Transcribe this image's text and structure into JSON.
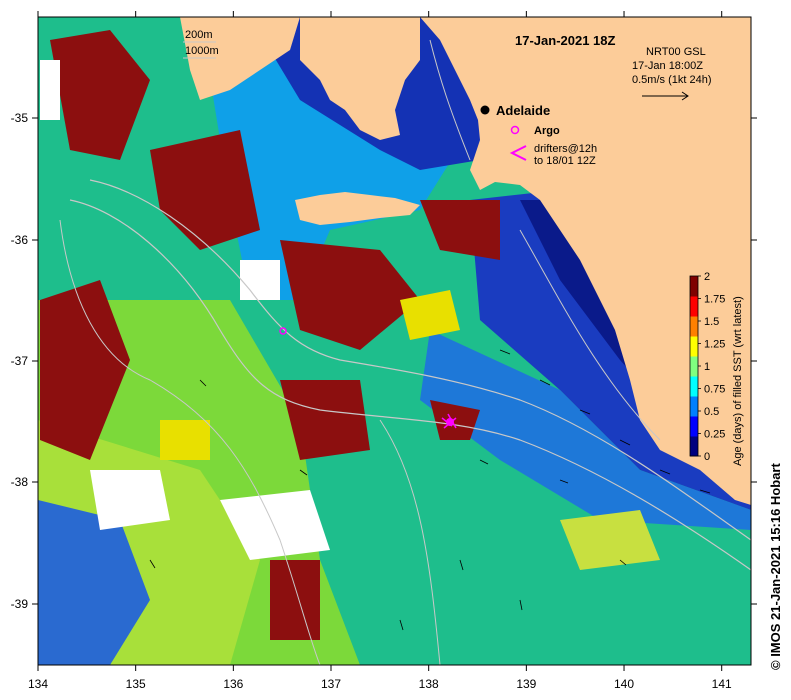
{
  "map": {
    "date_title": "17-Jan-2021 18Z",
    "product_line1": "NRT00 GSL",
    "product_line2": "17-Jan 18:00Z",
    "product_line3": "0.5m/s (1kt 24h)",
    "isobath_200": "200m",
    "isobath_1000": "1000m",
    "city_label": "Adelaide",
    "argo_label": "Argo",
    "drifter_label1": "drifters@12h",
    "drifter_label2": "to 18/01 12Z",
    "credit": "© IMOS 21-Jan-2021 15:16 Hobart",
    "colors": {
      "land": "#fccc99",
      "argo": "#ff00ff",
      "drifter": "#ff00ff"
    },
    "lon_ticks": [
      "134",
      "135",
      "136",
      "137",
      "138",
      "139",
      "140",
      "141"
    ],
    "lat_ticks": [
      "-35",
      "-36",
      "-37",
      "-38",
      "-39"
    ]
  },
  "colorbar": {
    "title": "Age (days) of filled SST (wrt latest)",
    "labels": [
      "2",
      "1.75",
      "1.5",
      "1.25",
      "1",
      "0.75",
      "0.5",
      "0.25",
      "0"
    ],
    "colors": [
      "#00007f",
      "#0000ff",
      "#0080ff",
      "#00ffff",
      "#80ff80",
      "#ffff00",
      "#ff8000",
      "#ff0000",
      "#7f0000"
    ]
  }
}
